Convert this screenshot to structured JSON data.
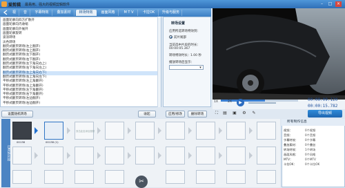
{
  "app": {
    "name": "爱剪辑",
    "slogan": "最易用、强大的视频剪辑软件"
  },
  "window_controls": {
    "min": "–",
    "max": "□",
    "close": "×"
  },
  "tabs": [
    "视",
    "音",
    "字幕特效",
    "叠加素材",
    "转场特效",
    "画面风格",
    "M T V",
    "卡拉OK",
    "升级与服务"
  ],
  "active_tab": "转场特效",
  "effect_list": [
    "画面轮廓向四方扩散开",
    "画面轮廓向内收缩",
    "画面轮廓向外展开",
    "画面轮廓旋转",
    "波浪转场",
    "淡色转场",
    "翻页式翻页转场(左上翻开)",
    "翻页式翻页转场(右上翻开)",
    "翻页式翻页转场(左下翻开)",
    "翻页式翻页转场(右下翻开)",
    "翻页式翻页转场(左下角向右上)",
    "翻页式翻页转场(右下角向左上)",
    "翻页式翻页转场(左上角向右下)",
    "翻页式翻页转场(右上角向左下)",
    "平移式翻页转场(左上角翻开)",
    "平移式翻页转场(右上角翻开)",
    "平移式翻页转场(左下角翻开)",
    "平移式翻页转场(右下角翻开)",
    "平移式翻页转场(左边翻开)",
    "平移式翻页转场(右边翻开)"
  ],
  "selected_effect": "翻页式翻页转场(左上角向右下)",
  "settings": {
    "title": "转场设置",
    "apply_to_label": "应用所选转场特效到：",
    "apply_option": "前片尾部",
    "duration_label": "当前选中片段的时长：",
    "duration_value": "00:00:05.367",
    "transition_time_label": "转场特效时长：",
    "transition_time_value": "1.00 秒",
    "transparency_label": "播放转场后显示：",
    "transparency_value": ""
  },
  "buttons": {
    "add_transition": "设置随机转场",
    "shrink": "收起",
    "apply_selected": "应用/修改",
    "delete_transition": "删除转场"
  },
  "player": {
    "speed_label": "1X",
    "step_label": "2X",
    "current_time": "00:00:09.120",
    "total_time": "00:00:15.782",
    "progress": 0.57,
    "export_label": "导出视频"
  },
  "timeline": {
    "track_label": "已添加片段",
    "clips": [
      {
        "label": "00138",
        "state": "filled"
      },
      {
        "label": "00138 (1)",
        "state": "selected"
      }
    ],
    "empty_hint": "双击此处添加视频"
  },
  "info_panel": {
    "title": "所有制作信息",
    "rows": [
      {
        "label": "视频：",
        "value": "0个视频"
      },
      {
        "label": "音频：",
        "value": "0个音频"
      },
      {
        "label": "字幕特效：",
        "value": "0个字幕"
      },
      {
        "label": "叠加素材：",
        "value": "0个叠加"
      },
      {
        "label": "转场特效：",
        "value": "1个转场"
      },
      {
        "label": "画面风格：",
        "value": "0个风格"
      },
      {
        "label": "MTV：",
        "value": "0个MTV"
      },
      {
        "label": "卡拉OK：",
        "value": "0个卡拉OK"
      }
    ]
  },
  "icons": {
    "logo": "aijianji-logo",
    "play": "play-icon",
    "trash": "trash-icon"
  },
  "colors": {
    "accent": "#2f6fb7",
    "selected_row": "#cfe4fa",
    "export": "#1f66b0"
  }
}
